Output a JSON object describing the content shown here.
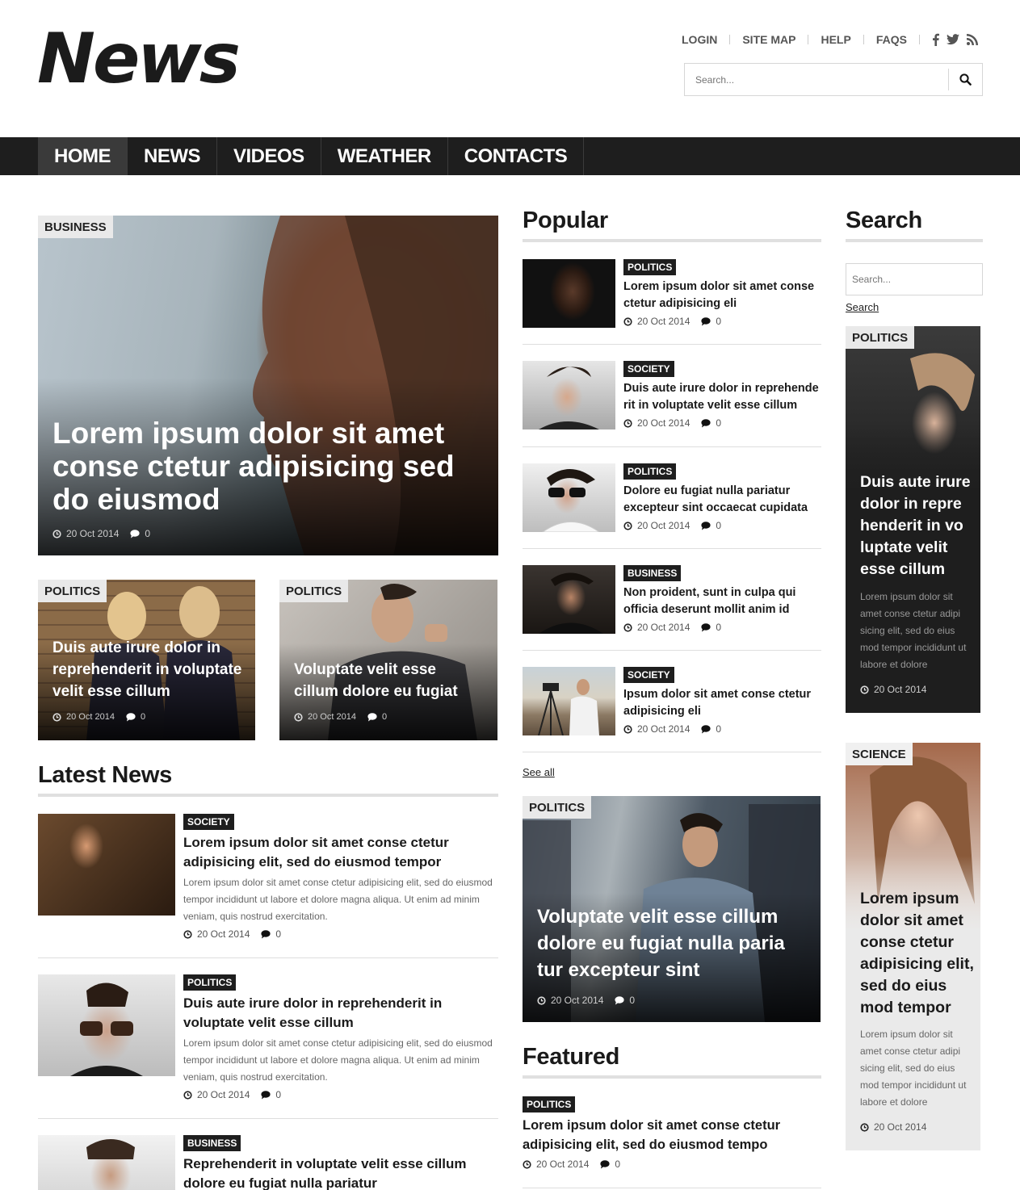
{
  "header": {
    "logo": "News",
    "links": [
      "LOGIN",
      "SITE MAP",
      "HELP",
      "FAQS"
    ],
    "social_icons": [
      "facebook-icon",
      "twitter-icon",
      "rss-icon"
    ],
    "search_placeholder": "Search..."
  },
  "nav": [
    "HOME",
    "NEWS",
    "VIDEOS",
    "WEATHER",
    "CONTACTS"
  ],
  "hero": {
    "category": "BUSINESS",
    "title": "Lorem ipsum dolor sit amet conse ctetur adipisicing sed do eiusmod",
    "date": "20 Oct 2014",
    "comments": "0"
  },
  "small_features": [
    {
      "category": "POLITICS",
      "title": "Duis aute irure dolor in reprehenderit in voluptate velit esse cillum",
      "date": "20 Oct 2014",
      "comments": "0"
    },
    {
      "category": "POLITICS",
      "title": "Voluptate velit esse cillum dolore eu fugiat",
      "date": "20 Oct 2014",
      "comments": "0"
    }
  ],
  "latest_news": {
    "title": "Latest News",
    "items": [
      {
        "category": "SOCIETY",
        "title": "Lorem ipsum dolor sit amet conse ctetur adipisicing elit, sed do eiusmod tempor",
        "text": "Lorem ipsum dolor sit amet conse ctetur adipisicing elit, sed do eiusmod tempor incididunt ut labore et dolore magna aliqua. Ut enim ad minim veniam, quis nostrud exercitation.",
        "date": "20 Oct 2014",
        "comments": "0"
      },
      {
        "category": "POLITICS",
        "title": "Duis aute irure dolor in reprehenderit in voluptate velit esse cillum",
        "text": "Lorem ipsum dolor sit amet conse ctetur adipisicing elit, sed do eiusmod tempor incididunt ut labore et dolore magna aliqua. Ut enim ad minim veniam, quis nostrud exercitation.",
        "date": "20 Oct 2014",
        "comments": "0"
      },
      {
        "category": "BUSINESS",
        "title": "Reprehenderit in voluptate velit esse cillum dolore eu fugiat nulla pariatur"
      }
    ]
  },
  "popular": {
    "title": "Popular",
    "items": [
      {
        "category": "POLITICS",
        "title": "Lorem ipsum dolor sit amet conse ctetur adipisicing eli",
        "date": "20 Oct 2014",
        "comments": "0"
      },
      {
        "category": "SOCIETY",
        "title": "Duis aute irure dolor in reprehende rit in voluptate velit esse cillum",
        "date": "20 Oct 2014",
        "comments": "0"
      },
      {
        "category": "POLITICS",
        "title": "Dolore eu fugiat nulla pariatur excepteur sint occaecat cupidata",
        "date": "20 Oct 2014",
        "comments": "0"
      },
      {
        "category": "BUSINESS",
        "title": "Non proident, sunt in culpa qui officia deserunt mollit anim id",
        "date": "20 Oct 2014",
        "comments": "0"
      },
      {
        "category": "SOCIETY",
        "title": "Ipsum dolor sit amet conse ctetur adipisicing eli",
        "date": "20 Oct 2014",
        "comments": "0"
      }
    ],
    "see_all": "See all"
  },
  "mid_feature": {
    "category": "POLITICS",
    "title": "Voluptate velit esse cillum dolore eu fugiat nulla paria tur excepteur sint",
    "date": "20 Oct 2014",
    "comments": "0"
  },
  "featured": {
    "title": "Featured",
    "items": [
      {
        "category": "POLITICS",
        "title": "Lorem ipsum dolor sit amet conse ctetur adipisicing elit, sed do eiusmod tempo",
        "date": "20 Oct 2014",
        "comments": "0"
      }
    ]
  },
  "sidebar": {
    "search_title": "Search",
    "search_placeholder": "Search...",
    "search_button": "Search",
    "cards": [
      {
        "category": "POLITICS",
        "title": "Duis aute irure dolor in repre henderit in vo luptate velit esse cillum",
        "text": "Lorem ipsum dolor sit amet conse ctetur adipi sicing elit, sed do eius mod tempor incididunt ut labore et dolore",
        "date": "20 Oct 2014"
      },
      {
        "category": "SCIENCE",
        "title": "Lorem ipsum dolor sit amet conse ctetur adipisicing elit, sed do eius mod tempor",
        "text": "Lorem ipsum dolor sit amet conse ctetur adipi sicing elit, sed do eius mod tempor incididunt ut labore et dolore",
        "date": "20 Oct 2014"
      }
    ]
  },
  "colors": {
    "dark": "#1e1e1e",
    "nav_active": "#3a3a3a",
    "rule": "#e0e0e0"
  }
}
